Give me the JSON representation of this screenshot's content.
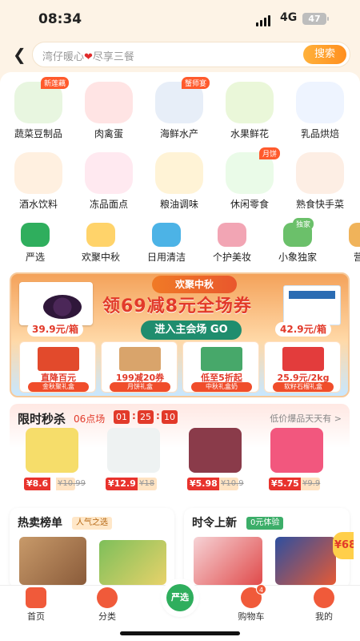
{
  "status": {
    "time": "08:34",
    "network": "4G",
    "battery": "47"
  },
  "search": {
    "placeholder_pre": "湾仔暖心",
    "placeholder_post": "尽享三餐",
    "button": "搜索"
  },
  "categories_row1": [
    {
      "label": "蔬菜豆制品",
      "tag": "新莲藕",
      "icon": "vegetable-icon",
      "color": "#e8f6e0"
    },
    {
      "label": "肉禽蛋",
      "tag": "",
      "icon": "meat-icon",
      "color": "#ffe4e4"
    },
    {
      "label": "海鲜水产",
      "tag": "蟹师宴",
      "icon": "seafood-icon",
      "color": "#e7eef8"
    },
    {
      "label": "水果鲜花",
      "tag": "",
      "icon": "fruit-icon",
      "color": "#eaf7d9"
    },
    {
      "label": "乳品烘焙",
      "tag": "",
      "icon": "dairy-icon",
      "color": "#eef4ff"
    }
  ],
  "categories_row2": [
    {
      "label": "酒水饮料",
      "tag": "",
      "icon": "wine-icon",
      "color": "#fff0e0"
    },
    {
      "label": "冻品面点",
      "tag": "",
      "icon": "icecream-icon",
      "color": "#ffe9f0"
    },
    {
      "label": "粮油调味",
      "tag": "",
      "icon": "oil-icon",
      "color": "#fff3d6"
    },
    {
      "label": "休闲零食",
      "tag": "月饼",
      "icon": "snack-icon",
      "color": "#eafbe8"
    },
    {
      "label": "熟食快手菜",
      "tag": "",
      "icon": "deli-icon",
      "color": "#fdeee4"
    }
  ],
  "categories_row3": [
    {
      "label": "严选",
      "icon": "yanxuan-icon",
      "color": "#2fae5d"
    },
    {
      "label": "欢聚中秋",
      "icon": "mooncake-icon",
      "color": "#ffd36a"
    },
    {
      "label": "日用清洁",
      "icon": "cleaning-icon",
      "color": "#4cb3e6"
    },
    {
      "label": "个护美妆",
      "icon": "cosmetics-icon",
      "color": "#f2a5b4"
    },
    {
      "label": "小象独家",
      "icon": "exclusive-icon",
      "color": "#6bc06a",
      "badge": "独家"
    },
    {
      "label": "营养",
      "icon": "nutrition-icon",
      "color": "#f0b35a"
    }
  ],
  "banner": {
    "pill": "欢聚中秋",
    "headline": "领69减8元全场券",
    "go": "进入主会场 GO",
    "left_price": "39.9元/箱",
    "right_price": "42.9元/箱",
    "subs": [
      {
        "title": "直降百元",
        "tag": "金秋聚礼盒",
        "color": "#e24a2c"
      },
      {
        "title": "199减20券",
        "tag": "月饼礼盒",
        "color": "#d9a46b"
      },
      {
        "title": "低至5折起",
        "tag": "中秋礼盒奶",
        "color": "#47a86a"
      },
      {
        "title": "25.9元/2kg",
        "tag": "软籽石榴礼盒",
        "color": "#e33c3c"
      }
    ]
  },
  "flash": {
    "title": "限时秒杀",
    "session": "06点场",
    "h": "01",
    "m": "25",
    "s": "10",
    "more": "低价爆品天天有 >",
    "items": [
      {
        "price": "¥8.6",
        "old": "¥10.99",
        "color": "#f6dd6a"
      },
      {
        "price": "¥12.9",
        "old": "¥18",
        "color": "#eef2f2"
      },
      {
        "price": "¥5.98",
        "old": "¥10.9",
        "color": "#8a3b4a"
      },
      {
        "price": "¥5.75",
        "old": "¥9.9",
        "color": "#f2577e"
      }
    ]
  },
  "hot": {
    "title": "热卖榜单",
    "badge": "人气之选"
  },
  "season": {
    "title": "时令上新",
    "badge": "0元体验",
    "float_price": "¥68"
  },
  "tabbar": [
    {
      "label": "首页",
      "icon": "home-icon"
    },
    {
      "label": "分类",
      "icon": "category-icon"
    },
    {
      "label": "严选",
      "icon": "yanxuan-tab-icon"
    },
    {
      "label": "购物车",
      "icon": "cart-icon",
      "count": "4"
    },
    {
      "label": "我的",
      "icon": "profile-icon"
    }
  ],
  "colors": {
    "accent": "#ff8f1f",
    "red": "#e23a2a",
    "green": "#2fae5d"
  }
}
